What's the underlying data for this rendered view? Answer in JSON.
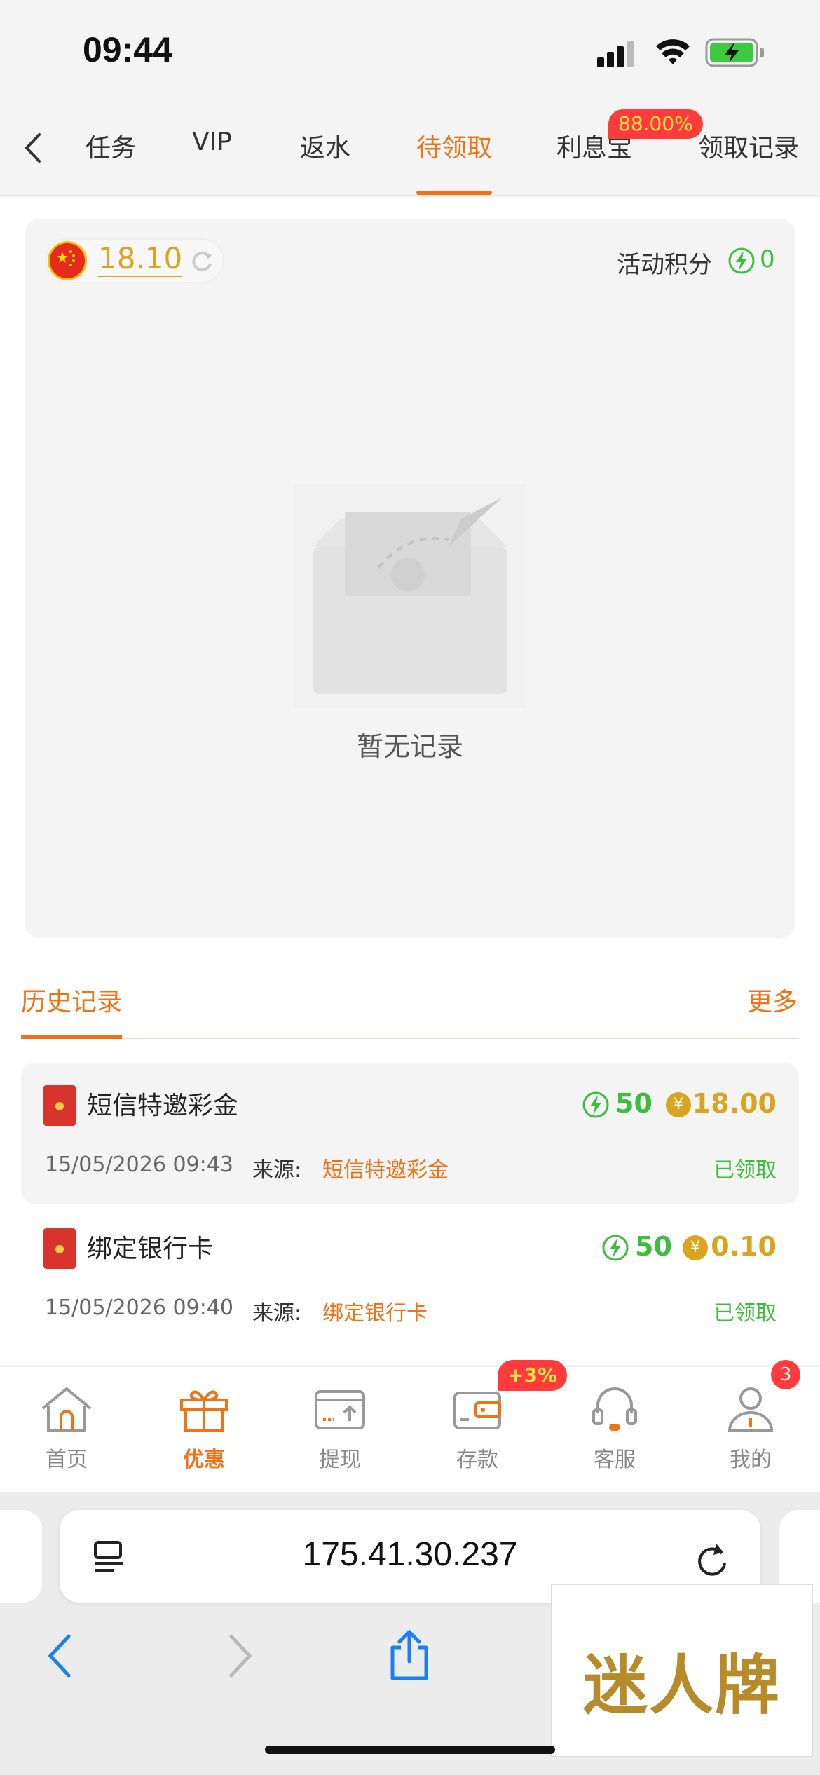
{
  "status_bar": {
    "time": "09:44"
  },
  "tabs": [
    {
      "label": "任务",
      "active": false
    },
    {
      "label": "VIP",
      "active": false
    },
    {
      "label": "返水",
      "active": false
    },
    {
      "label": "待领取",
      "active": true
    },
    {
      "label": "利息宝",
      "active": false,
      "badge": "88.00%"
    },
    {
      "label": "领取记录",
      "active": false
    }
  ],
  "balance": {
    "value": "18.10",
    "flag": "china-flag"
  },
  "activity_points": {
    "label": "活动积分",
    "value": "0"
  },
  "empty_state": {
    "text": "暂无记录"
  },
  "history": {
    "title": "历史记录",
    "more": "更多",
    "source_label": "来源:",
    "records": [
      {
        "title": "短信特邀彩金",
        "points": "50",
        "amount": "18.00",
        "date": "15/05/2026 09:43",
        "source": "短信特邀彩金",
        "status": "已领取"
      },
      {
        "title": "绑定银行卡",
        "points": "50",
        "amount": "0.10",
        "date": "15/05/2026 09:40",
        "source": "绑定银行卡",
        "status": "已领取"
      }
    ]
  },
  "bottom_nav": [
    {
      "label": "首页",
      "icon": "home-icon"
    },
    {
      "label": "优惠",
      "icon": "gift-icon",
      "active": true
    },
    {
      "label": "提现",
      "icon": "withdraw-icon"
    },
    {
      "label": "存款",
      "icon": "wallet-icon",
      "badge": "+3%"
    },
    {
      "label": "客服",
      "icon": "headset-icon"
    },
    {
      "label": "我的",
      "icon": "user-icon",
      "badge": "3"
    }
  ],
  "browser": {
    "url": "175.41.30.237"
  },
  "watermark": {
    "text": "迷人牌"
  },
  "colors": {
    "accent": "#f07216",
    "green": "#3dbd3d",
    "gold": "#d9a520",
    "badge": "#ff3b3b"
  }
}
